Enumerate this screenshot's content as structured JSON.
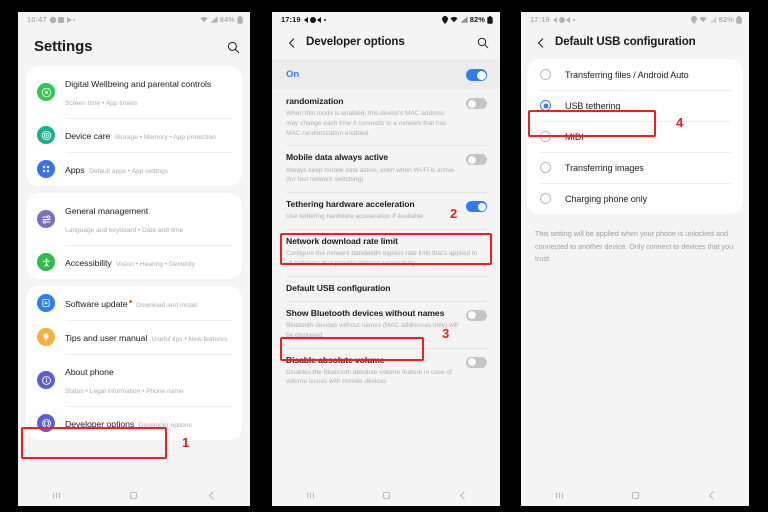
{
  "phone1": {
    "status": {
      "time": "10:47",
      "battery": "84%"
    },
    "header": {
      "title": "Settings",
      "search_icon": "search-icon"
    },
    "groups": [
      {
        "items": [
          {
            "title": "Digital Wellbeing and parental controls",
            "sub": "Screen time  •  App timers",
            "icon": "wellbeing-icon",
            "color": "#2dc84d"
          },
          {
            "title": "Device care",
            "sub": "Storage  •  Memory  •  App protection",
            "icon": "device-care-icon",
            "color": "#18b08e"
          },
          {
            "title": "Apps",
            "sub": "Default apps  •  App settings",
            "icon": "apps-icon",
            "color": "#3a6ff0"
          }
        ]
      },
      {
        "items": [
          {
            "title": "General management",
            "sub": "Language and keyboard  •  Date and time",
            "icon": "sliders-icon",
            "color": "#7d6ec4"
          },
          {
            "title": "Accessibility",
            "sub": "Vision  •  Hearing  •  Dexterity",
            "icon": "accessibility-icon",
            "color": "#2dbb4d"
          }
        ]
      },
      {
        "items": [
          {
            "title": "Software update",
            "sub": "Download and install",
            "icon": "software-update-icon",
            "color": "#2f7df6",
            "badge": true
          },
          {
            "title": "Tips and user manual",
            "sub": "Useful tips  •  New features",
            "icon": "tips-bulb-icon",
            "color": "#f4b23c"
          },
          {
            "title": "About phone",
            "sub": "Status  •  Legal information  •  Phone name",
            "icon": "info-icon",
            "color": "#5c5fd0"
          },
          {
            "title": "Developer options",
            "sub": "Developer options",
            "icon": "developer-options-icon",
            "color": "#5c5fd0"
          }
        ]
      }
    ]
  },
  "phone2": {
    "status": {
      "time": "17:19",
      "battery": "82%"
    },
    "header": {
      "title": "Developer options",
      "back_icon": "back-chevron-icon",
      "search_icon": "search-icon"
    },
    "master_switch": {
      "label": "On",
      "enabled": true
    },
    "rows": [
      {
        "title": "randomization",
        "sub": "When this mode is enabled, this device's MAC address may change each time it connects to a network that has MAC randomization enabled.",
        "toggle": "off"
      },
      {
        "title": "Mobile data always active",
        "sub": "Always keep mobile data active, even when Wi-Fi is active (for fast network switching)",
        "toggle": "off"
      },
      {
        "title": "Tethering hardware acceleration",
        "sub": "Use tethering hardware acceleration if available",
        "toggle": "on"
      },
      {
        "title": "Network download rate limit",
        "sub": "Configure the network bandwidth ingress rate limit that's applied to all networks that provide internet connectivity.",
        "toggle": "none"
      },
      {
        "title": "Default USB configuration",
        "sub": "",
        "toggle": "none"
      },
      {
        "title": "Show Bluetooth devices without names",
        "sub": "Bluetooth devices without names (MAC addresses only) will be displayed",
        "toggle": "off"
      },
      {
        "title": "Disable absolute volume",
        "sub": "Disables the Bluetooth absolute volume feature in case of volume issues with remote devices",
        "toggle": "off"
      }
    ]
  },
  "phone3": {
    "status": {
      "time": "17:19",
      "battery": "82%"
    },
    "header": {
      "title": "Default USB configuration",
      "back_icon": "back-chevron-icon"
    },
    "options": [
      {
        "label": "Transferring files / Android Auto",
        "selected": false
      },
      {
        "label": "USB tethering",
        "selected": true
      },
      {
        "label": "MIDI",
        "selected": false
      },
      {
        "label": "Transferring images",
        "selected": false
      },
      {
        "label": "Charging phone only",
        "selected": false
      }
    ],
    "footnote": "This setting will be applied when your phone is unlocked and connected to another device. Only connect to devices that you trust."
  },
  "annotations": {
    "marker1": "1",
    "marker2": "2",
    "marker3": "3",
    "marker4": "4",
    "color": "#f41c1c"
  },
  "navbar": {
    "recents_icon": "recents-icon",
    "home_icon": "home-icon",
    "back_icon": "back-icon"
  }
}
